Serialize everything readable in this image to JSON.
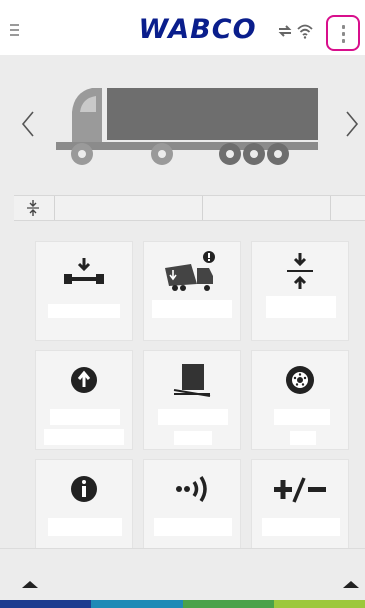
{
  "header": {
    "logo": "WABCO"
  },
  "icons": {
    "menu": "hamburger-menu-icon",
    "sync": "sync-arrows-icon",
    "wifi": "wifi-icon",
    "more": "more-vertical-icon",
    "prev": "chevron-left-icon",
    "next": "chevron-right-icon",
    "height": "height-adjust-icon"
  },
  "tiles": [
    {
      "icon": "axle-lift-icon"
    },
    {
      "icon": "trailer-tipping-warning-icon"
    },
    {
      "icon": "level-control-icon"
    },
    {
      "icon": "raise-up-icon"
    },
    {
      "icon": "tilt-angle-icon"
    },
    {
      "icon": "tyre-icon"
    },
    {
      "icon": "info-icon"
    },
    {
      "icon": "signal-transmit-icon"
    },
    {
      "icon": "plus-minus-icon"
    }
  ],
  "colors": {
    "accent_outline": "#d80f8c",
    "logo_blue": "#0a1e8c",
    "strip": [
      "#1d3c8f",
      "#1e8ab6",
      "#4aa24a",
      "#9cc83c"
    ]
  }
}
